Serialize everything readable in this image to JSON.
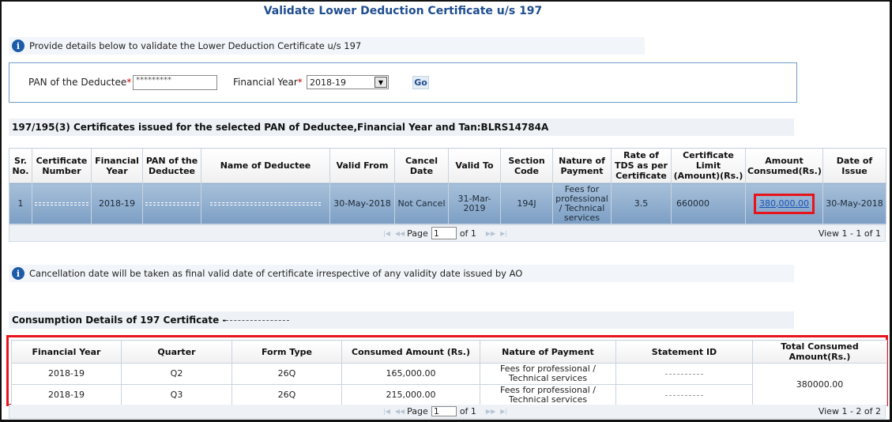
{
  "page": {
    "title": "Validate Lower Deduction Certificate u/s 197"
  },
  "info1": "Provide details below to validate the Lower Deduction Certificate u/s 197",
  "form": {
    "pan_label": "PAN of the Deductee",
    "pan_required": "*",
    "pan_value": "*********",
    "fy_label": "Financial Year",
    "fy_required": "*",
    "fy_value": "2018-19",
    "go_label": "Go"
  },
  "certificates": {
    "heading": "197/195(3) Certificates issued for the selected PAN of Deductee,Financial Year and Tan:BLRS14784A",
    "columns": [
      "Sr. No.",
      "Certificate Number",
      "Financial Year",
      "PAN of the Deductee",
      "Name of Deductee",
      "Valid From",
      "Cancel Date",
      "Valid To",
      "Section Code",
      "Nature of Payment",
      "Rate of TDS as per Certificate",
      "Certificate Limit (Amount)(Rs.)",
      "Amount Consumed(Rs.)",
      "Date of Issue"
    ],
    "row": {
      "sr_no": "1",
      "financial_year": "2018-19",
      "valid_from": "30-May-2018",
      "cancel_date": "Not Cancel",
      "valid_to": "31-Mar-2019",
      "section_code": "194J",
      "nature_of_payment": "Fees for professional / Technical services",
      "rate": "3.5",
      "limit": "660000",
      "amount_consumed": "380,000.00",
      "date_of_issue": "30-May-2018"
    },
    "pager": {
      "page_label": "Page",
      "page_value": "1",
      "of_label": "of 1",
      "view_text": "View 1 - 1 of 1"
    }
  },
  "info2": "Cancellation date will be taken as final valid date of certificate irrespective of any validity date issued by AO",
  "consumption": {
    "heading": "Consumption Details of 197 Certificate - ",
    "columns": [
      "Financial Year",
      "Quarter",
      "Form Type",
      "Consumed Amount (Rs.)",
      "Nature of Payment",
      "Statement ID",
      "Total Consumed Amount(Rs.)"
    ],
    "rows": [
      {
        "fy": "2018-19",
        "quarter": "Q2",
        "form": "26Q",
        "amount": "165,000.00",
        "nature": "Fees for professional / Technical services"
      },
      {
        "fy": "2018-19",
        "quarter": "Q3",
        "form": "26Q",
        "amount": "215,000.00",
        "nature": "Fees for professional / Technical services"
      }
    ],
    "total": "380000.00",
    "pager": {
      "page_label": "Page",
      "page_value": "1",
      "of_label": "of 1",
      "view_text": "View 1 - 2 of 2"
    }
  },
  "colors": {
    "title": "#1f4d8f",
    "highlight": "#e8141b",
    "selected_row": "#8fadce"
  }
}
